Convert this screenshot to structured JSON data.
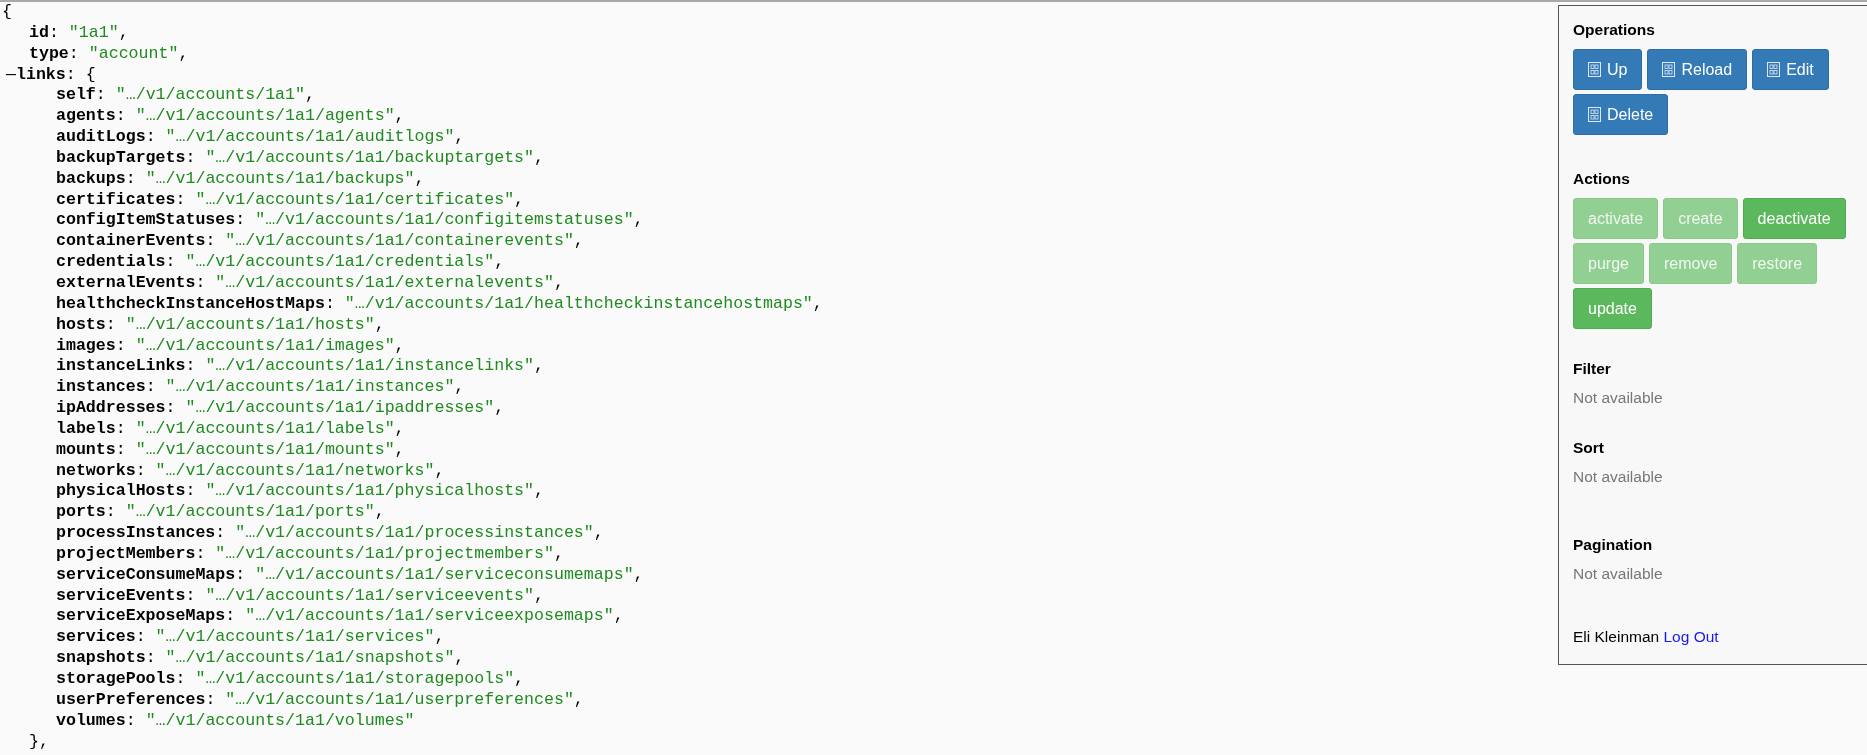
{
  "document": {
    "open": "{",
    "fields": [
      {
        "key": "id",
        "colon": ":",
        "value": "\"1a1\"",
        "comma": ","
      },
      {
        "key": "type",
        "colon": ":",
        "value": "\"account\"",
        "comma": ","
      }
    ],
    "links": {
      "toggle": "—",
      "expanded": true,
      "key": "links",
      "colon": ":",
      "open": "{",
      "close": "},",
      "entries": [
        {
          "key": "self",
          "colon": ":",
          "value": "\"…/v1/accounts/1a1\"",
          "comma": ","
        },
        {
          "key": "agents",
          "colon": ":",
          "value": "\"…/v1/accounts/1a1/agents\"",
          "comma": ","
        },
        {
          "key": "auditLogs",
          "colon": ":",
          "value": "\"…/v1/accounts/1a1/auditlogs\"",
          "comma": ","
        },
        {
          "key": "backupTargets",
          "colon": ":",
          "value": "\"…/v1/accounts/1a1/backuptargets\"",
          "comma": ","
        },
        {
          "key": "backups",
          "colon": ":",
          "value": "\"…/v1/accounts/1a1/backups\"",
          "comma": ","
        },
        {
          "key": "certificates",
          "colon": ":",
          "value": "\"…/v1/accounts/1a1/certificates\"",
          "comma": ","
        },
        {
          "key": "configItemStatuses",
          "colon": ":",
          "value": "\"…/v1/accounts/1a1/configitemstatuses\"",
          "comma": ","
        },
        {
          "key": "containerEvents",
          "colon": ":",
          "value": "\"…/v1/accounts/1a1/containerevents\"",
          "comma": ","
        },
        {
          "key": "credentials",
          "colon": ":",
          "value": "\"…/v1/accounts/1a1/credentials\"",
          "comma": ","
        },
        {
          "key": "externalEvents",
          "colon": ":",
          "value": "\"…/v1/accounts/1a1/externalevents\"",
          "comma": ","
        },
        {
          "key": "healthcheckInstanceHostMaps",
          "colon": ":",
          "value": "\"…/v1/accounts/1a1/healthcheckinstancehostmaps\"",
          "comma": ","
        },
        {
          "key": "hosts",
          "colon": ":",
          "value": "\"…/v1/accounts/1a1/hosts\"",
          "comma": ","
        },
        {
          "key": "images",
          "colon": ":",
          "value": "\"…/v1/accounts/1a1/images\"",
          "comma": ","
        },
        {
          "key": "instanceLinks",
          "colon": ":",
          "value": "\"…/v1/accounts/1a1/instancelinks\"",
          "comma": ","
        },
        {
          "key": "instances",
          "colon": ":",
          "value": "\"…/v1/accounts/1a1/instances\"",
          "comma": ","
        },
        {
          "key": "ipAddresses",
          "colon": ":",
          "value": "\"…/v1/accounts/1a1/ipaddresses\"",
          "comma": ","
        },
        {
          "key": "labels",
          "colon": ":",
          "value": "\"…/v1/accounts/1a1/labels\"",
          "comma": ","
        },
        {
          "key": "mounts",
          "colon": ":",
          "value": "\"…/v1/accounts/1a1/mounts\"",
          "comma": ","
        },
        {
          "key": "networks",
          "colon": ":",
          "value": "\"…/v1/accounts/1a1/networks\"",
          "comma": ","
        },
        {
          "key": "physicalHosts",
          "colon": ":",
          "value": "\"…/v1/accounts/1a1/physicalhosts\"",
          "comma": ","
        },
        {
          "key": "ports",
          "colon": ":",
          "value": "\"…/v1/accounts/1a1/ports\"",
          "comma": ","
        },
        {
          "key": "processInstances",
          "colon": ":",
          "value": "\"…/v1/accounts/1a1/processinstances\"",
          "comma": ","
        },
        {
          "key": "projectMembers",
          "colon": ":",
          "value": "\"…/v1/accounts/1a1/projectmembers\"",
          "comma": ","
        },
        {
          "key": "serviceConsumeMaps",
          "colon": ":",
          "value": "\"…/v1/accounts/1a1/serviceconsumemaps\"",
          "comma": ","
        },
        {
          "key": "serviceEvents",
          "colon": ":",
          "value": "\"…/v1/accounts/1a1/serviceevents\"",
          "comma": ","
        },
        {
          "key": "serviceExposeMaps",
          "colon": ":",
          "value": "\"…/v1/accounts/1a1/serviceexposemaps\"",
          "comma": ","
        },
        {
          "key": "services",
          "colon": ":",
          "value": "\"…/v1/accounts/1a1/services\"",
          "comma": ","
        },
        {
          "key": "snapshots",
          "colon": ":",
          "value": "\"…/v1/accounts/1a1/snapshots\"",
          "comma": ","
        },
        {
          "key": "storagePools",
          "colon": ":",
          "value": "\"…/v1/accounts/1a1/storagepools\"",
          "comma": ","
        },
        {
          "key": "userPreferences",
          "colon": ":",
          "value": "\"…/v1/accounts/1a1/userpreferences\"",
          "comma": ","
        },
        {
          "key": "volumes",
          "colon": ":",
          "value": "\"…/v1/accounts/1a1/volumes\""
        }
      ]
    }
  },
  "panel": {
    "operations": {
      "title": "Operations",
      "buttons": [
        {
          "label": "Up"
        },
        {
          "label": "Reload"
        },
        {
          "label": "Edit"
        },
        {
          "label": "Delete"
        }
      ]
    },
    "actions": {
      "title": "Actions",
      "buttons": [
        {
          "label": "activate",
          "disabled": true
        },
        {
          "label": "create",
          "disabled": true
        },
        {
          "label": "deactivate",
          "disabled": false
        },
        {
          "label": "purge",
          "disabled": true
        },
        {
          "label": "remove",
          "disabled": true
        },
        {
          "label": "restore",
          "disabled": true
        },
        {
          "label": "update",
          "disabled": false
        }
      ]
    },
    "sections": [
      {
        "title": "Filter",
        "text": "Not available"
      },
      {
        "title": "Sort",
        "text": "Not available"
      },
      {
        "title": "Pagination",
        "text": "Not available"
      }
    ],
    "footer": {
      "user": "Eli Kleinman",
      "link": "Log Out"
    }
  }
}
